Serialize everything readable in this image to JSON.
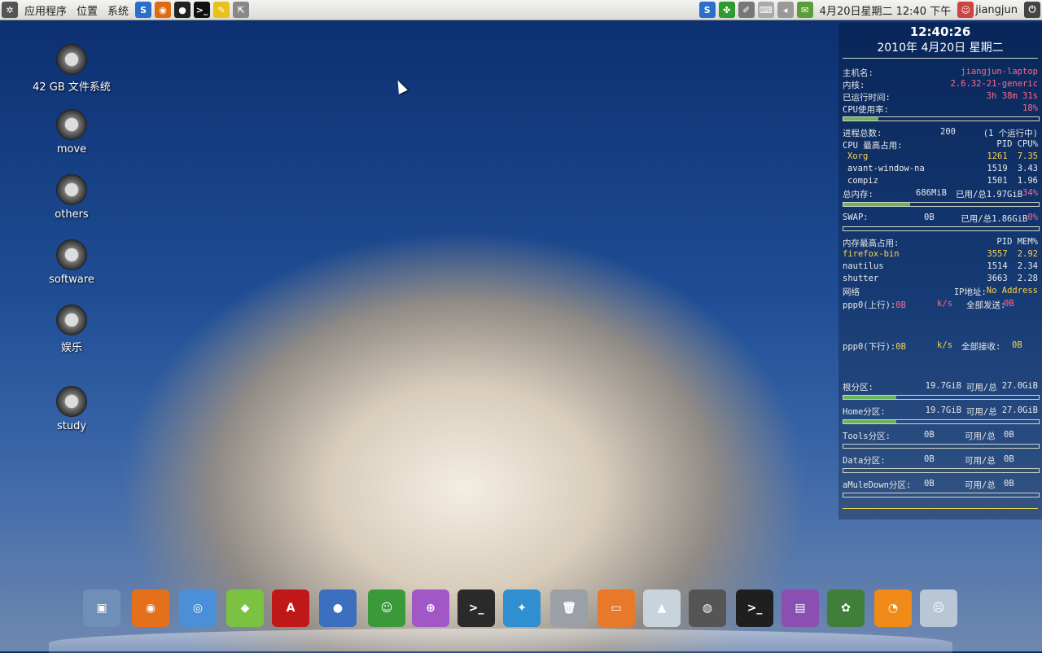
{
  "top_panel": {
    "menus": [
      "应用程序",
      "位置",
      "系统"
    ],
    "launchers": [
      "ubuntu-logo-icon",
      "linux-tag-icon",
      "firefox-icon",
      "qq-penguin-icon",
      "terminal-icon",
      "notes-icon",
      "screenshot-icon"
    ],
    "indicators": [
      "s-app-icon",
      "green-clover-icon",
      "pen-icon",
      "keyboard-icon",
      "volume-icon",
      "mail-icon"
    ],
    "clock": "4月20日星期二 12:40 下午",
    "user": "jiangjun"
  },
  "desktop": {
    "icons": [
      {
        "label": "42 GB 文件系统"
      },
      {
        "label": "move"
      },
      {
        "label": "others"
      },
      {
        "label": "software"
      },
      {
        "label": "娱乐"
      },
      {
        "label": "study"
      }
    ]
  },
  "conky": {
    "time": "12:40:26",
    "date": "2010年 4月20日 星期二",
    "hostname_label": "主机名:",
    "hostname": "jiangjun-laptop",
    "kernel_label": "内核:",
    "kernel": "2.6.32-21-generic",
    "uptime_label": "已运行时间:",
    "uptime": "3h 38m 31s",
    "cpu_label": "CPU使用率:",
    "cpu_usage": "18%",
    "cpu_fraction": 0.18,
    "proc_label": "进程总数:",
    "proc_total": "200",
    "proc_running": "(1     个运行中)",
    "cpu_top_label": "CPU 最高占用:",
    "cpu_top_header": "PID  CPU%",
    "cpu_top": [
      {
        "name": "Xorg",
        "pid": "1261",
        "val": "7.35"
      },
      {
        "name": "avant-window-na",
        "pid": "1519",
        "val": "3.43"
      },
      {
        "name": "compiz",
        "pid": "1501",
        "val": "1.96"
      }
    ],
    "mem_label": "总内存:",
    "mem_used": "686MiB",
    "mem_total": "已用/总1.97GiB",
    "mem_pct": "34%",
    "mem_fraction": 0.34,
    "swap_label": "SWAP:",
    "swap_used": "0B",
    "swap_total": "已用/总1.86GiB",
    "swap_pct": "0%",
    "swap_fraction": 0.0,
    "mem_top_label": "内存最高占用:",
    "mem_top_header": "PID  MEM%",
    "mem_top": [
      {
        "name": "firefox-bin",
        "pid": "3557",
        "val": "2.92"
      },
      {
        "name": "nautilus",
        "pid": "1514",
        "val": "2.34"
      },
      {
        "name": "shutter",
        "pid": "3663",
        "val": "2.28"
      }
    ],
    "net_label": "网络",
    "ip_label": "IP地址:",
    "ip": "No Address",
    "up_label": "ppp0(上行):",
    "up_val": "0B",
    "up_unit": "k/s",
    "up_total_label": "全部发送:",
    "up_total": "0B",
    "down_label": "ppp0(下行):",
    "down_val": "0B",
    "down_unit": "k/s",
    "down_total_label": "全部接收:",
    "down_total": "0B",
    "disks": [
      {
        "label": "根分区:",
        "free": "19.7GiB",
        "mid": "可用/总",
        "total": "27.0GiB",
        "fraction": 0.27
      },
      {
        "label": "Home分区:",
        "free": "19.7GiB",
        "mid": "可用/总",
        "total": "27.0GiB",
        "fraction": 0.27
      },
      {
        "label": "Tools分区:",
        "free": "0B",
        "mid": "可用/总",
        "total": "0B",
        "fraction": 0
      },
      {
        "label": "Data分区:",
        "free": "0B",
        "mid": "可用/总",
        "total": "0B",
        "fraction": 0
      },
      {
        "label": "aMuleDown分区:",
        "free": "0B",
        "mid": "可用/总",
        "total": "0B",
        "fraction": 0
      }
    ]
  },
  "dock": {
    "items": [
      {
        "icon": "show-desktop-icon",
        "color": "#6f8fb8",
        "glyph": "▣"
      },
      {
        "icon": "firefox-icon",
        "color": "#e5701c",
        "glyph": "◉"
      },
      {
        "icon": "chrome-icon",
        "color": "#4a8fd8",
        "glyph": "◎"
      },
      {
        "icon": "ubuntu-software-icon",
        "color": "#7bc142",
        "glyph": "◆"
      },
      {
        "icon": "adobe-reader-icon",
        "color": "#c01818",
        "glyph": "A"
      },
      {
        "icon": "pidgin-icon",
        "color": "#3c6fbf",
        "glyph": "●"
      },
      {
        "icon": "messenger-icon",
        "color": "#3a9a3a",
        "glyph": "☺"
      },
      {
        "icon": "browser-globe-icon",
        "color": "#a257c7",
        "glyph": "⊕"
      },
      {
        "icon": "terminal-icon",
        "color": "#2a2a2a",
        "glyph": ">_"
      },
      {
        "icon": "swirl-app-icon",
        "color": "#2f8fd0",
        "glyph": "✦"
      },
      {
        "icon": "trash-icon",
        "color": "#9aa0a6",
        "glyph": "🗑"
      },
      {
        "icon": "folder-icon",
        "color": "#e8792a",
        "glyph": "▭"
      },
      {
        "icon": "mountain-icon",
        "color": "#c9d3dc",
        "glyph": "▲"
      },
      {
        "icon": "speaker-icon",
        "color": "#555555",
        "glyph": "◍"
      },
      {
        "icon": "terminal-icon-2",
        "color": "#1f1f1f",
        "glyph": ">_"
      },
      {
        "icon": "window-manager-icon",
        "color": "#8a4fb0",
        "glyph": "▤"
      },
      {
        "icon": "turtle-icon",
        "color": "#3f7f3a",
        "glyph": "✿"
      },
      {
        "icon": "rss-icon",
        "color": "#f08a19",
        "glyph": "◔"
      },
      {
        "icon": "sad-window-icon",
        "color": "#b8c7d6",
        "glyph": "☹"
      }
    ]
  }
}
